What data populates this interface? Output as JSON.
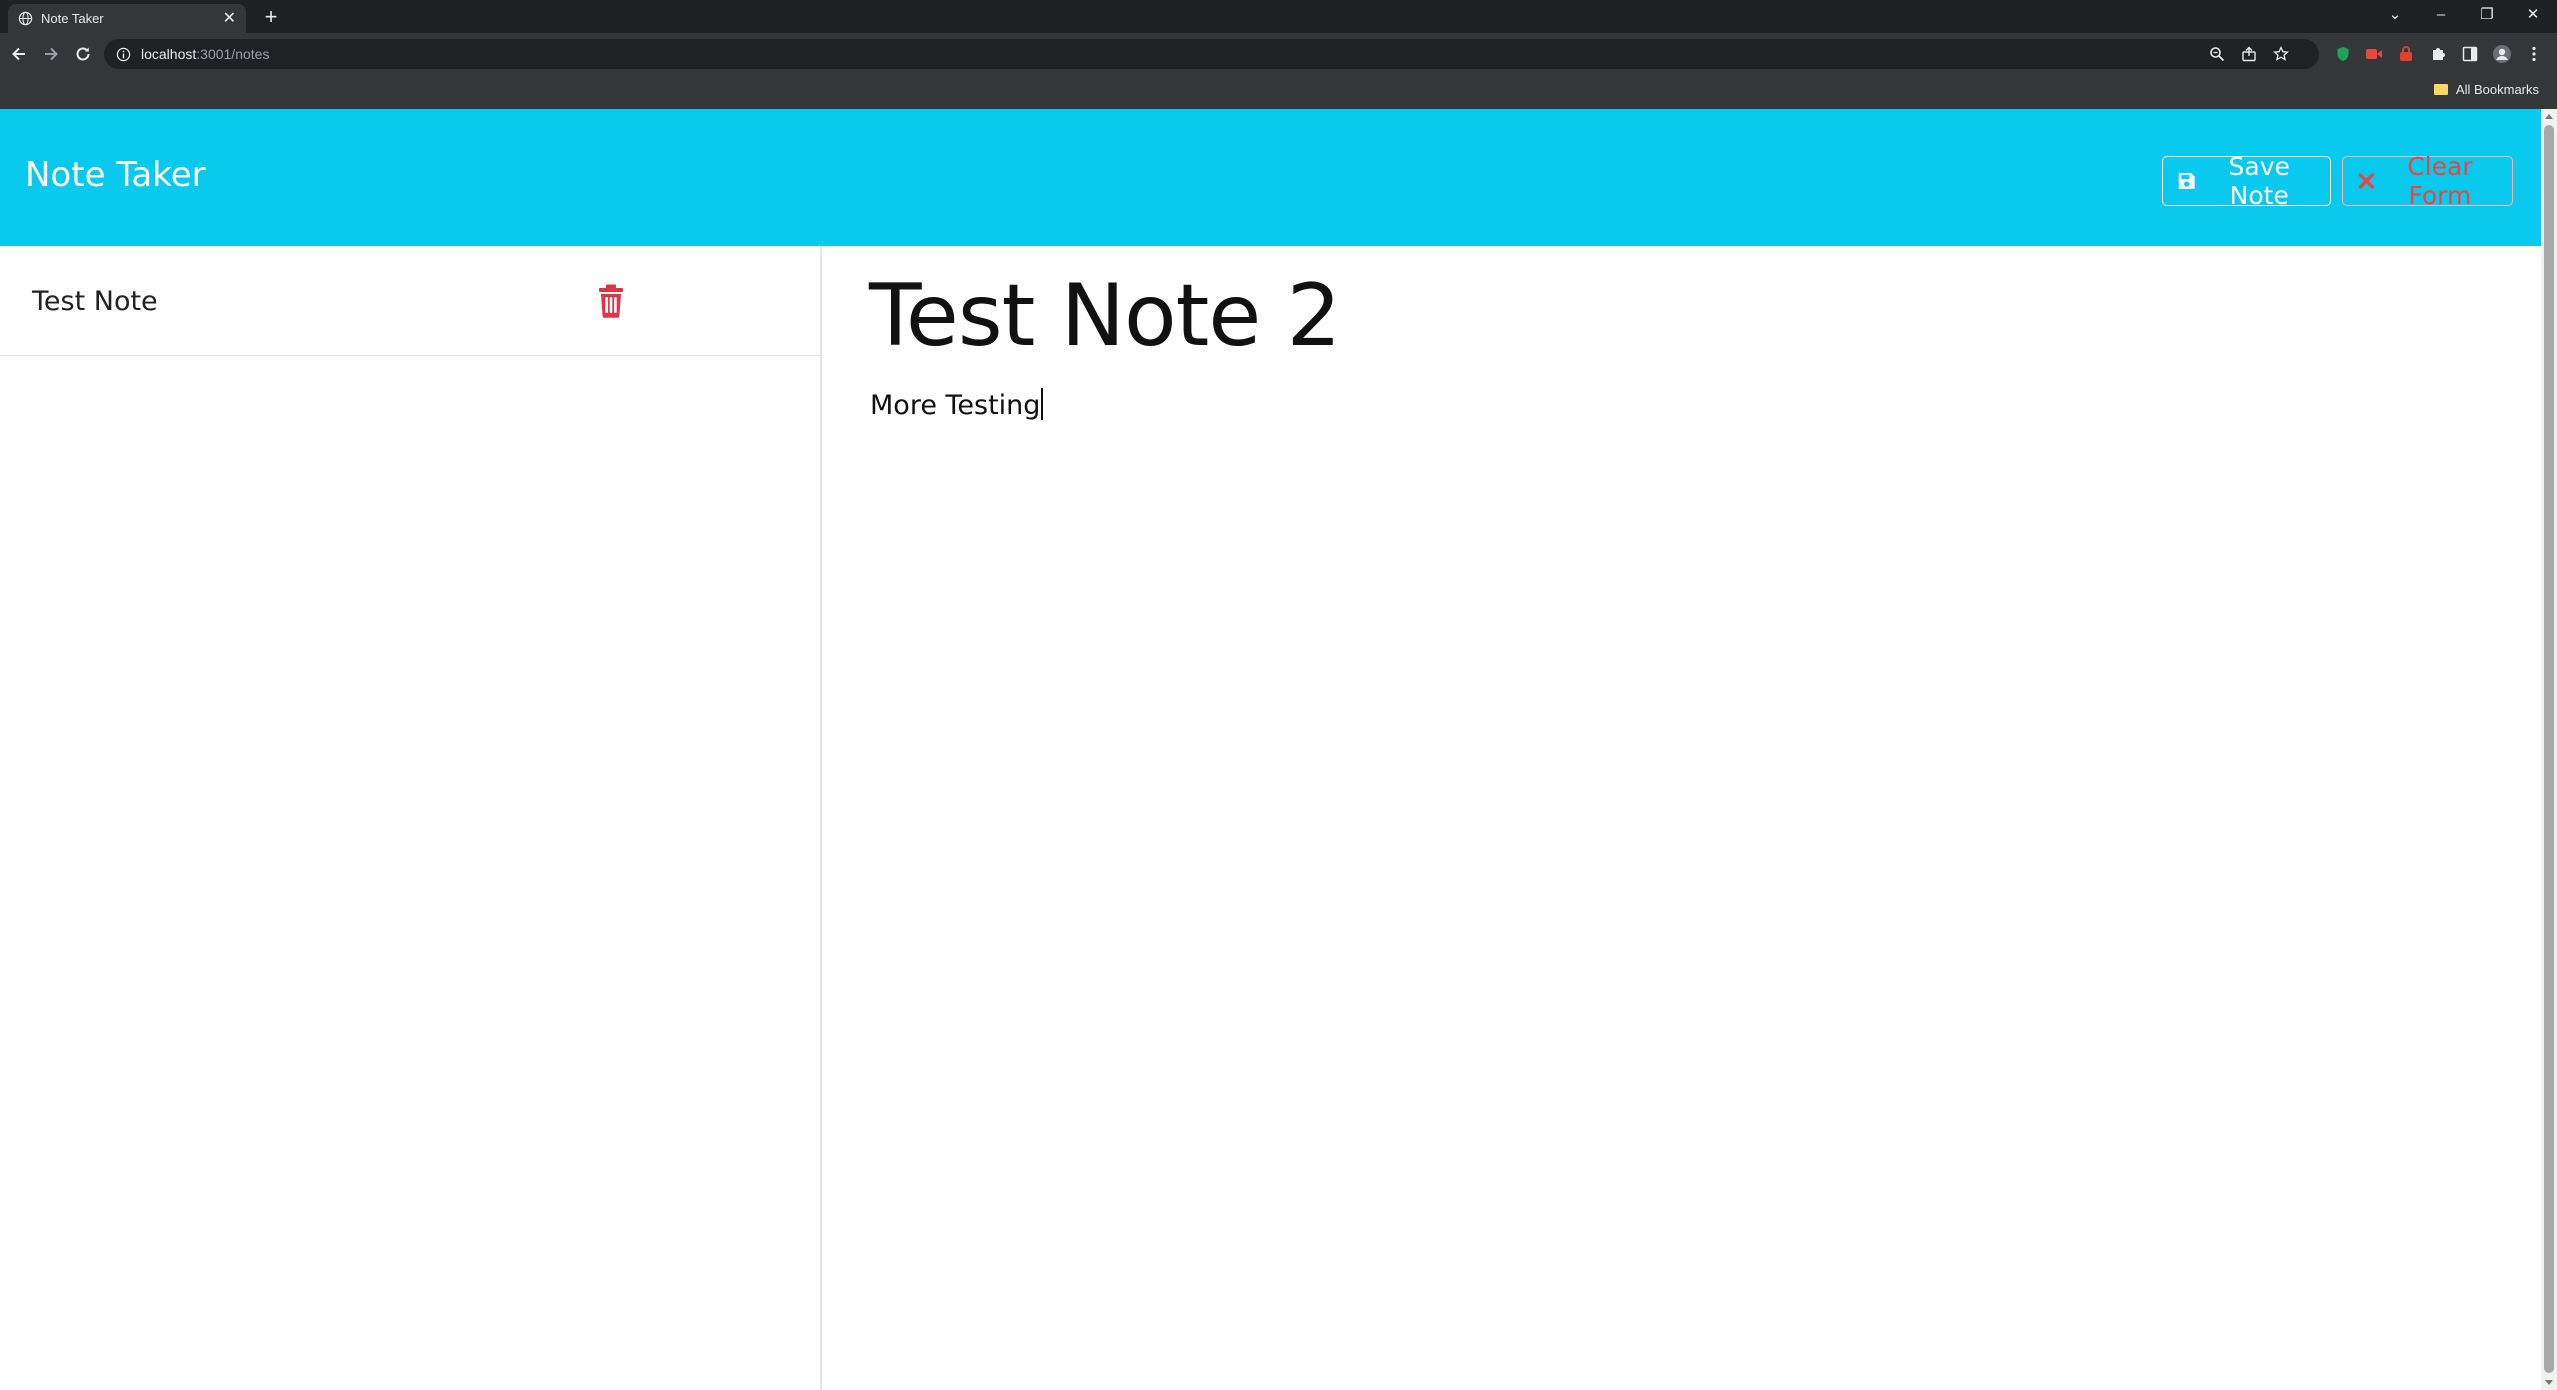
{
  "browser": {
    "tab_title": "Note Taker",
    "tab_close": "✕",
    "new_tab": "+",
    "url_host": "localhost",
    "url_path": ":3001/notes",
    "bookmarks_label": "All Bookmarks",
    "window_controls": [
      "⌄",
      "–",
      "❐",
      "✕"
    ]
  },
  "app": {
    "brand": "Note Taker",
    "save_label": "Save Note",
    "clear_label": "Clear Form",
    "accent_color": "#09c9ef",
    "danger_color": "#e8473d"
  },
  "notes_list": [
    {
      "title": "Test Note"
    }
  ],
  "editor": {
    "title": "Test Note 2",
    "text": "More Testing"
  }
}
